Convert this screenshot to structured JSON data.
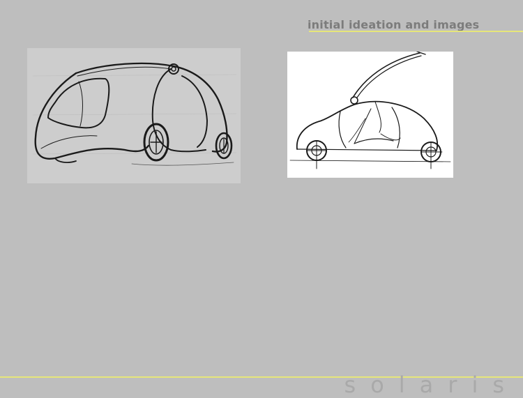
{
  "slide": {
    "title": "initial ideation and images",
    "footer_logo": "solaris"
  },
  "colors": {
    "background": "#bebebe",
    "accent_rule": "#e6e67a",
    "title_text": "#7c7c7c",
    "logo_text": "#a9a9a9"
  }
}
